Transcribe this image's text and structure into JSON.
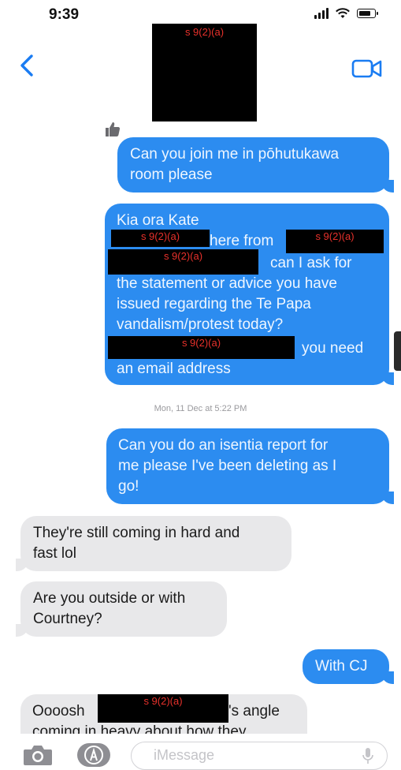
{
  "status_bar": {
    "time": "9:39"
  },
  "header": {
    "contact_redaction": "s 9(2)(a)"
  },
  "messages": {
    "m1": {
      "line1": "Can you join me in pōhutukawa",
      "line2": "room please"
    },
    "m2": {
      "line1": "Kia ora Kate",
      "redact_a": "s 9(2)(a)",
      "line2_text": "here from",
      "redact_b": "s 9(2)(a)",
      "redact_c": "s 9(2)(a)",
      "line3_text": "can I ask for",
      "line4": "the statement or advice you have",
      "line5": "issued regarding the Te Papa",
      "line6": "vandalism/protest today?",
      "redact_d": "s 9(2)(a)",
      "line7_text": "you need",
      "line8": "an email address"
    },
    "timestamp": "Mon, 11 Dec at 5:22 PM",
    "m3": {
      "line1": "Can you do an isentia report for",
      "line2": "me please I've been deleting as I",
      "line3": "go!"
    },
    "m4": {
      "line1": "They're still coming in hard and",
      "line2": "fast lol"
    },
    "m5": {
      "line1": "Are you outside or with",
      "line2": "Courtney?"
    },
    "m6": {
      "text": "With CJ"
    },
    "m7": {
      "line1_start": "Oooosh",
      "redact": "s 9(2)(a)",
      "line1_end": "'s angle",
      "line2": "coming in heavy about how they"
    }
  },
  "input_bar": {
    "placeholder": "iMessage"
  },
  "colors": {
    "sent_bubble": "#2c8cf0",
    "received_bubble": "#e8e8ea",
    "accent": "#1a7cf2",
    "redaction_label": "#e8312b"
  },
  "icons": [
    "back-chevron-icon",
    "video-call-icon",
    "thumbs-up-icon",
    "camera-icon",
    "app-store-icon",
    "microphone-icon",
    "signal-icon",
    "wifi-icon",
    "battery-icon"
  ]
}
